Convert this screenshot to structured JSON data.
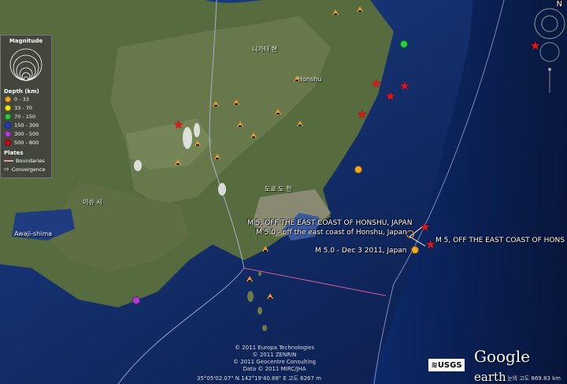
{
  "legend": {
    "title": "Magnitude",
    "mag_scale": [
      "8",
      "7",
      "6",
      "5",
      "4",
      "3",
      "2"
    ],
    "depth_title": "Depth (km)",
    "depth": [
      {
        "label": "0 - 33",
        "color": "#f5a623"
      },
      {
        "label": "33 - 70",
        "color": "#f8e71c"
      },
      {
        "label": "70 - 150",
        "color": "#2ecc40"
      },
      {
        "label": "150 - 300",
        "color": "#1f3bd6"
      },
      {
        "label": "300 - 500",
        "color": "#b63ed8"
      },
      {
        "label": "500 - 800",
        "color": "#d0021b"
      }
    ],
    "plates_title": "Plates",
    "boundaries": "Boundaries",
    "convergence": "Convergence"
  },
  "events": [
    {
      "label": "M 5, OFF THE EAST COAST OF HONSHU, JAPAN"
    },
    {
      "label": "M 5.0 - off the east coast of Honshu, Japan"
    },
    {
      "label": "M 5, OFF THE EAST COAST OF HONS"
    },
    {
      "label": "M 5.0 - Dec  3 2011, Japan"
    }
  ],
  "places": {
    "niigata": "니가타 현",
    "awaji": "Awaji-shima",
    "tokyo": "도쿄 도 천",
    "region_a": "이슈 시",
    "region_b": "Honshu"
  },
  "credits": {
    "line1": "© 2011 Europa Technologies",
    "line2": "© 2011 ZENRIN",
    "line3": "© 2011 Geocentre Consulting",
    "line4": "Data © 2011 MIRC/JHA"
  },
  "status_bar": "35°05'02.07\" N  142°19'40.88\" E  고도  6267 m",
  "eye_alt": "눈의 고도  869.83 km",
  "branding": {
    "usgs": "≋USGS",
    "ge_google": "Google",
    "ge_earth": "earth"
  },
  "nav": {
    "north": "N"
  }
}
